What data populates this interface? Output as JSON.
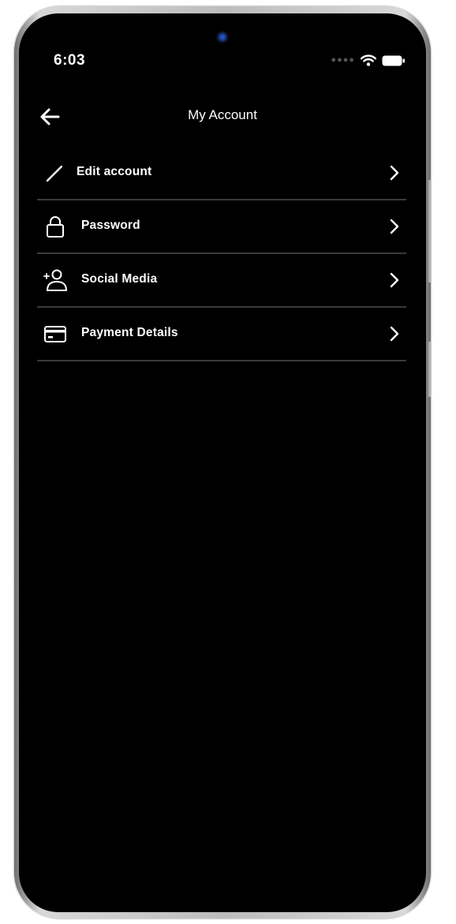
{
  "status_bar": {
    "time": "6:03",
    "signal_icon": "signal-dots-icon",
    "wifi_icon": "wifi-icon",
    "battery_icon": "battery-icon"
  },
  "header": {
    "title": "My Account",
    "back_icon": "arrow-left-icon"
  },
  "menu": {
    "items": [
      {
        "label": "Edit account",
        "icon": "pencil-icon"
      },
      {
        "label": "Password",
        "icon": "lock-icon"
      },
      {
        "label": "Social Media",
        "icon": "add-user-icon"
      },
      {
        "label": "Payment Details",
        "icon": "credit-card-icon"
      }
    ]
  },
  "colors": {
    "background": "#000000",
    "text": "#ffffff",
    "divider": "#3a3a3a"
  }
}
